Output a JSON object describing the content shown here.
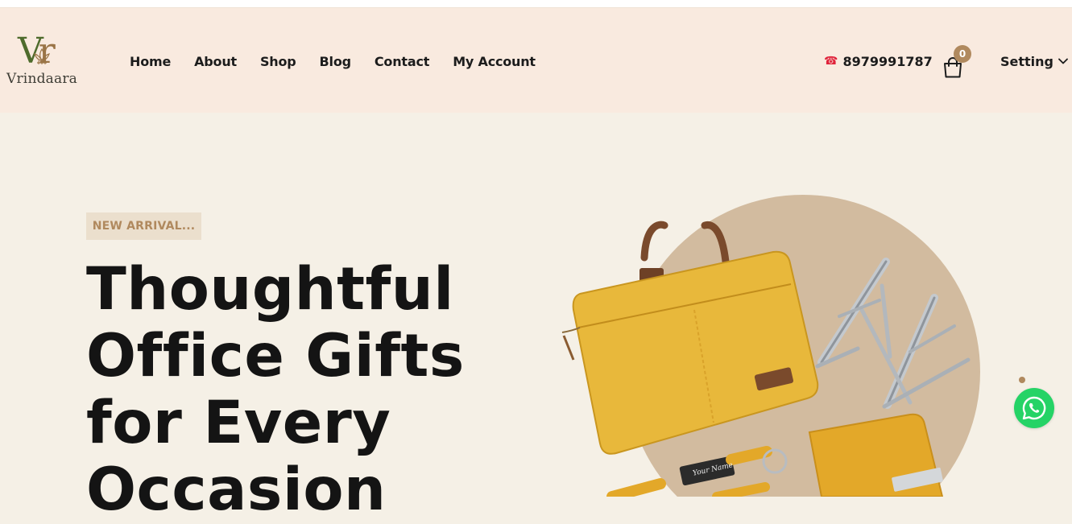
{
  "brand": {
    "monogram_v": "V",
    "monogram_r": "r",
    "name": "Vrindaara"
  },
  "nav": {
    "items": [
      "Home",
      "About",
      "Shop",
      "Blog",
      "Contact",
      "My Account"
    ]
  },
  "header": {
    "phone_icon": "☎",
    "phone": "8979991787",
    "cart_count": "0",
    "setting_label": "Setting"
  },
  "hero": {
    "tag": "NEW ARRIVAL...",
    "title_lines": [
      "Thoughtful",
      "Office Gifts",
      "for Every",
      "Occasion"
    ],
    "engraving": "Your Name"
  },
  "colors": {
    "accent": "#b0895e",
    "header_bg": "#f9eadf",
    "page_bg": "#f5f0e6",
    "whatsapp": "#25d366"
  },
  "icons": [
    "phone-icon",
    "shopping-bag-icon",
    "chevron-down-icon",
    "whatsapp-icon",
    "lotus-icon"
  ]
}
